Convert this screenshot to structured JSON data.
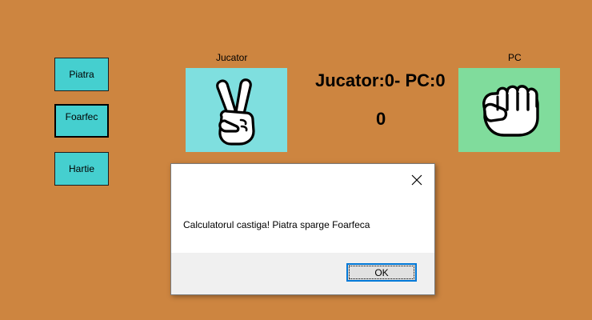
{
  "buttons": {
    "rock": "Piatra",
    "scissors": "Foarfec",
    "paper": "Hartie"
  },
  "player": {
    "label": "Jucator",
    "hand_icon": "scissors-hand-icon",
    "panel_color": "#7fdfdf"
  },
  "pc": {
    "label": "PC",
    "hand_icon": "rock-fist-icon",
    "panel_color": "#80dc9c"
  },
  "score": {
    "text": "Jucator:0- PC:0",
    "counter": "0"
  },
  "dialog": {
    "message": "Calculatorul castiga! Piatra sparge Foarfeca",
    "ok_label": "OK"
  },
  "colors": {
    "background": "#cd8540",
    "button": "#45cfcf",
    "ok_focus": "#0078d7"
  }
}
